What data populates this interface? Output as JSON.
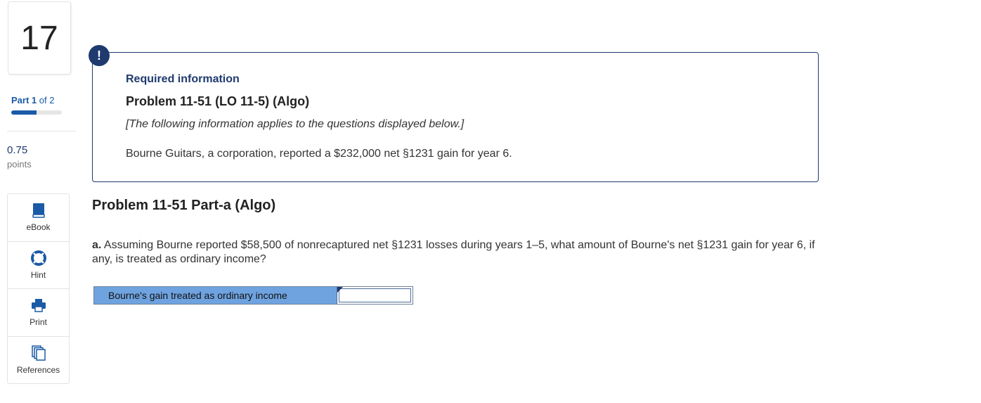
{
  "question_number": "17",
  "part": {
    "label": "Part",
    "current": "1",
    "of_text": "of 2",
    "progress_fraction": 0.5
  },
  "points": {
    "value": "0.75",
    "label": "points"
  },
  "tools": [
    {
      "label": "eBook",
      "icon": "book-icon"
    },
    {
      "label": "Hint",
      "icon": "lifebuoy-icon"
    },
    {
      "label": "Print",
      "icon": "printer-icon"
    },
    {
      "label": "References",
      "icon": "documents-icon"
    }
  ],
  "info": {
    "alert_symbol": "!",
    "required": "Required information",
    "problem_title": "Problem 11-51 (LO 11-5) (Algo)",
    "note": "[The following information applies to the questions displayed below.]",
    "text": "Bourne Guitars, a corporation, reported a $232,000 net §1231 gain for year 6."
  },
  "part_title": "Problem 11-51 Part-a (Algo)",
  "question": {
    "prefix": "a.",
    "text": " Assuming Bourne reported $58,500 of nonrecaptured net §1231 losses during years 1–5, what amount of Bourne's net §1231 gain for year 6, if any, is treated as ordinary income?"
  },
  "answer": {
    "label": "Bourne's gain treated as ordinary income",
    "value": ""
  },
  "colors": {
    "brand_navy": "#1e3a6e",
    "link_blue": "#1a5aa6",
    "label_bg": "#6fa3e0"
  }
}
